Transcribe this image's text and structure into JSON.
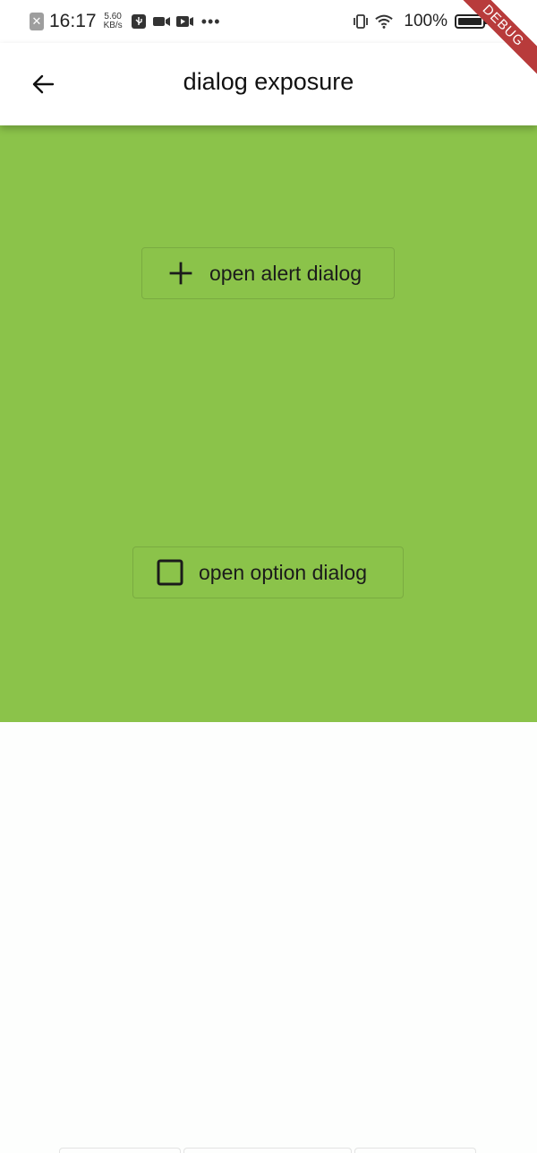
{
  "status_bar": {
    "time": "16:17",
    "net_speed_value": "5.60",
    "net_speed_unit": "KB/s",
    "battery_percent": "100%",
    "icons": [
      "close-notification-icon",
      "usb-icon",
      "video-camera-icon",
      "screen-record-icon",
      "more-dots-icon",
      "vibrate-icon",
      "wifi-icon",
      "battery-icon"
    ]
  },
  "debug_banner": "DEBUG",
  "app_bar": {
    "title": "dialog exposure",
    "back_icon": "arrow-back-icon"
  },
  "content": {
    "background_color": "#8bc34a",
    "buttons": [
      {
        "label": "open alert dialog",
        "icon": "add-icon"
      },
      {
        "label": "open option dialog",
        "icon": "checkbox-outline-icon"
      }
    ]
  }
}
